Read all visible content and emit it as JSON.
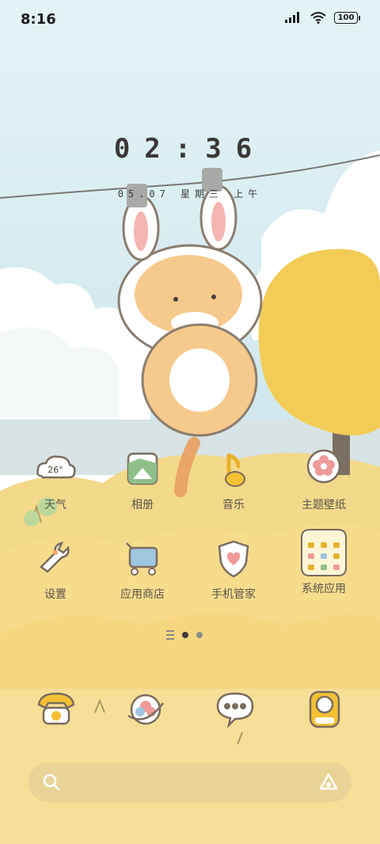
{
  "status_bar": {
    "time": "8:16",
    "battery": "100"
  },
  "clock_widget": {
    "time": "02:36",
    "date": "05.07 星期三 上午"
  },
  "apps_row1": [
    {
      "label": "天气",
      "icon": "weather-icon",
      "temp": "26°"
    },
    {
      "label": "相册",
      "icon": "gallery-icon"
    },
    {
      "label": "音乐",
      "icon": "music-icon"
    },
    {
      "label": "主题壁纸",
      "icon": "themes-icon"
    }
  ],
  "apps_row2": [
    {
      "label": "设置",
      "icon": "settings-icon"
    },
    {
      "label": "应用商店",
      "icon": "app-store-icon"
    },
    {
      "label": "手机管家",
      "icon": "security-icon"
    },
    {
      "label": "系统应用",
      "icon": "system-apps-folder-icon"
    }
  ],
  "dock": [
    "phone-icon",
    "browser-icon",
    "messages-icon",
    "camera-icon"
  ],
  "page_indicator": {
    "pages": 2,
    "current": 1
  },
  "colors": {
    "sky": "#dff0f2",
    "ground": "#f6dc8e",
    "label": "#5a544c"
  }
}
